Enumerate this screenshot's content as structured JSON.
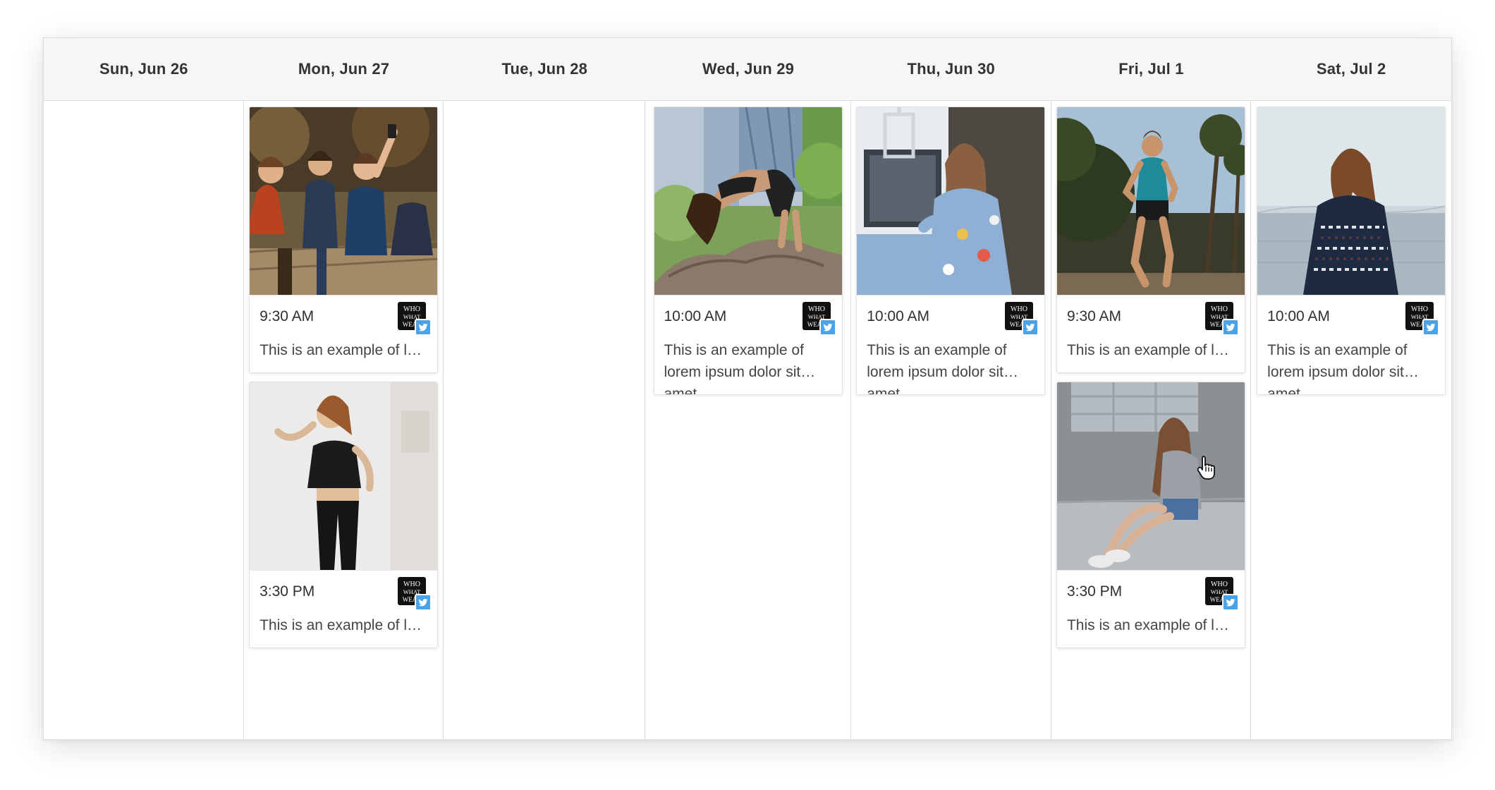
{
  "calendar": {
    "days": [
      {
        "label": "Sun, Jun 26",
        "posts": []
      },
      {
        "label": "Mon, Jun 27",
        "posts": [
          {
            "time": "9:30 AM",
            "caption": "This is an example of lorem ipsum dolor sit amet",
            "image": "friends-selfie-photo"
          },
          {
            "time": "3:30 PM",
            "caption": "This is an example of lorem ipsum dolor sit amet",
            "image": "woman-black-outfit-photo"
          }
        ]
      },
      {
        "label": "Tue, Jun 28",
        "posts": []
      },
      {
        "label": "Wed, Jun 29",
        "posts": [
          {
            "time": "10:00 AM",
            "caption": "This is an example of lorem ipsum dolor sit amet",
            "image": "yoga-rock-photo"
          }
        ]
      },
      {
        "label": "Thu, Jun 30",
        "posts": [
          {
            "time": "10:00 AM",
            "caption": "This is an example of lorem ipsum dolor sit amet",
            "image": "denim-jacket-van-photo"
          }
        ]
      },
      {
        "label": "Fri, Jul 1",
        "posts": [
          {
            "time": "9:30 AM",
            "caption": "This is an example of lorem ipsum dolor sit amet",
            "image": "runner-palms-photo"
          },
          {
            "time": "3:30 PM",
            "caption": "This is an example of lorem ipsum dolor sit amet",
            "image": "girl-sitting-floor-photo"
          }
        ]
      },
      {
        "label": "Sat, Jul 2",
        "posts": [
          {
            "time": "10:00 AM",
            "caption": "This is an example of lorem ipsum dolor sit amet",
            "image": "sweater-seaside-photo"
          }
        ]
      }
    ]
  },
  "account": {
    "logo_text": [
      "WHO",
      "WHAT",
      "WEAR"
    ],
    "network_icon": "twitter-icon",
    "network_color": "#4aa3e8"
  },
  "colors": {
    "header_bg": "#f6f6f6",
    "grid_line": "#dcdcdc",
    "text_primary": "#333333",
    "logo_bg": "#111111"
  }
}
